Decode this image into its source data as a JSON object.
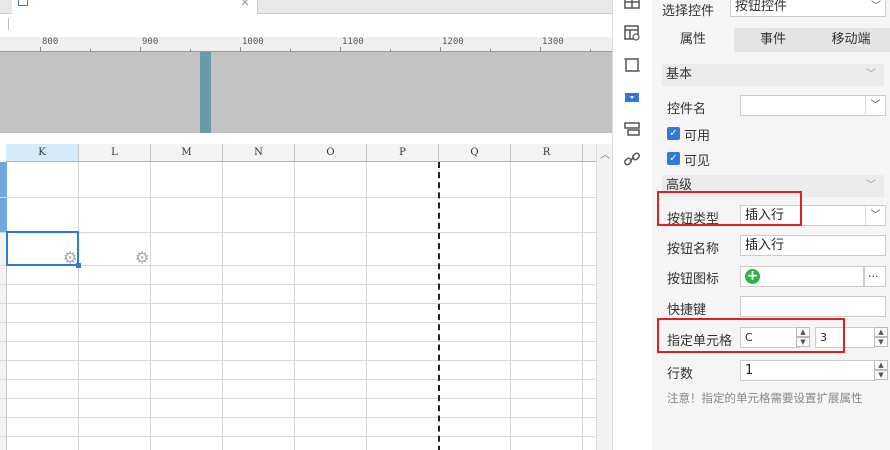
{
  "tab": {
    "close_icon": "×"
  },
  "ruler": {
    "labels": [
      "800",
      "900",
      "1000",
      "1100",
      "1200",
      "1300"
    ]
  },
  "grid": {
    "columns": [
      "K",
      "L",
      "M",
      "N",
      "O",
      "P",
      "Q",
      "R"
    ],
    "selected_column": "K"
  },
  "panel": {
    "select_control_label": "选择控件",
    "select_control_value": "按钮控件",
    "tabs": [
      "属性",
      "事件",
      "移动端"
    ],
    "basic_section": "基本",
    "control_name_label": "控件名",
    "control_name_value": "",
    "enabled_label": "可用",
    "visible_label": "可见",
    "advanced_section": "高级",
    "button_type_label": "按钮类型",
    "button_type_value": "插入行",
    "button_name_label": "按钮名称",
    "button_name_value": "插入行",
    "button_icon_label": "按钮图标",
    "button_icon_more": "···",
    "shortcut_label": "快捷键",
    "shortcut_value": "",
    "target_cell_label": "指定单元格",
    "target_cell_col": "C",
    "target_cell_row": "3",
    "row_count_label": "行数",
    "row_count_value": "1",
    "note": "注意！指定的单元格需要设置扩展属性"
  },
  "colors": {
    "highlight": "#e02020",
    "accent": "#2f7ad6"
  }
}
